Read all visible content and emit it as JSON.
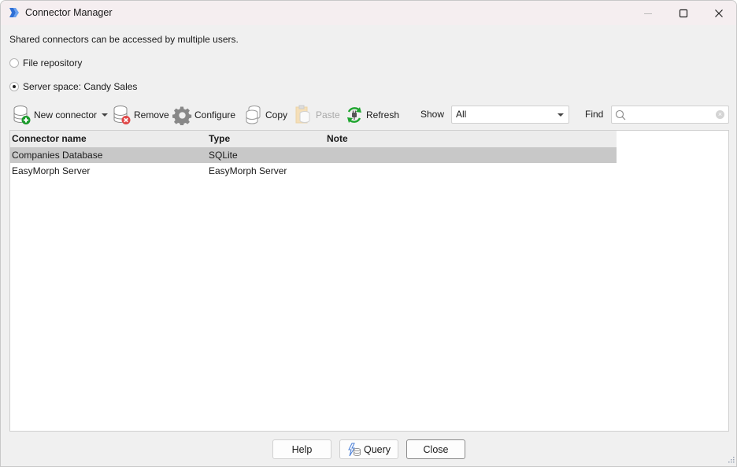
{
  "window": {
    "title": "Connector Manager",
    "controls": {
      "minimize": "minimize",
      "maximize": "maximize",
      "close": "close"
    }
  },
  "description": "Shared connectors can be accessed by multiple users.",
  "location": {
    "options": [
      {
        "label": "File repository",
        "selected": false
      },
      {
        "label": "Server space: Candy Sales",
        "selected": true
      }
    ]
  },
  "toolbar": {
    "new_connector": "New connector",
    "remove": "Remove",
    "configure": "Configure",
    "copy": "Copy",
    "paste": "Paste",
    "refresh": "Refresh",
    "show_label": "Show",
    "show_value": "All",
    "find_label": "Find",
    "find_value": "",
    "find_placeholder": ""
  },
  "grid": {
    "columns": [
      "Connector name",
      "Type",
      "Note"
    ],
    "rows": [
      {
        "name": "Companies Database",
        "type": "SQLite",
        "note": "",
        "selected": true
      },
      {
        "name": "EasyMorph Server",
        "type": "EasyMorph Server",
        "note": "",
        "selected": false
      }
    ]
  },
  "footer": {
    "help": "Help",
    "query": "Query",
    "close": "Close"
  },
  "colors": {
    "accent_blue": "#2f6fd6",
    "add_green": "#1a9a2a",
    "remove_red": "#e04848",
    "refresh_green": "#1ea52e",
    "selected_row": "#c8c8c8"
  }
}
